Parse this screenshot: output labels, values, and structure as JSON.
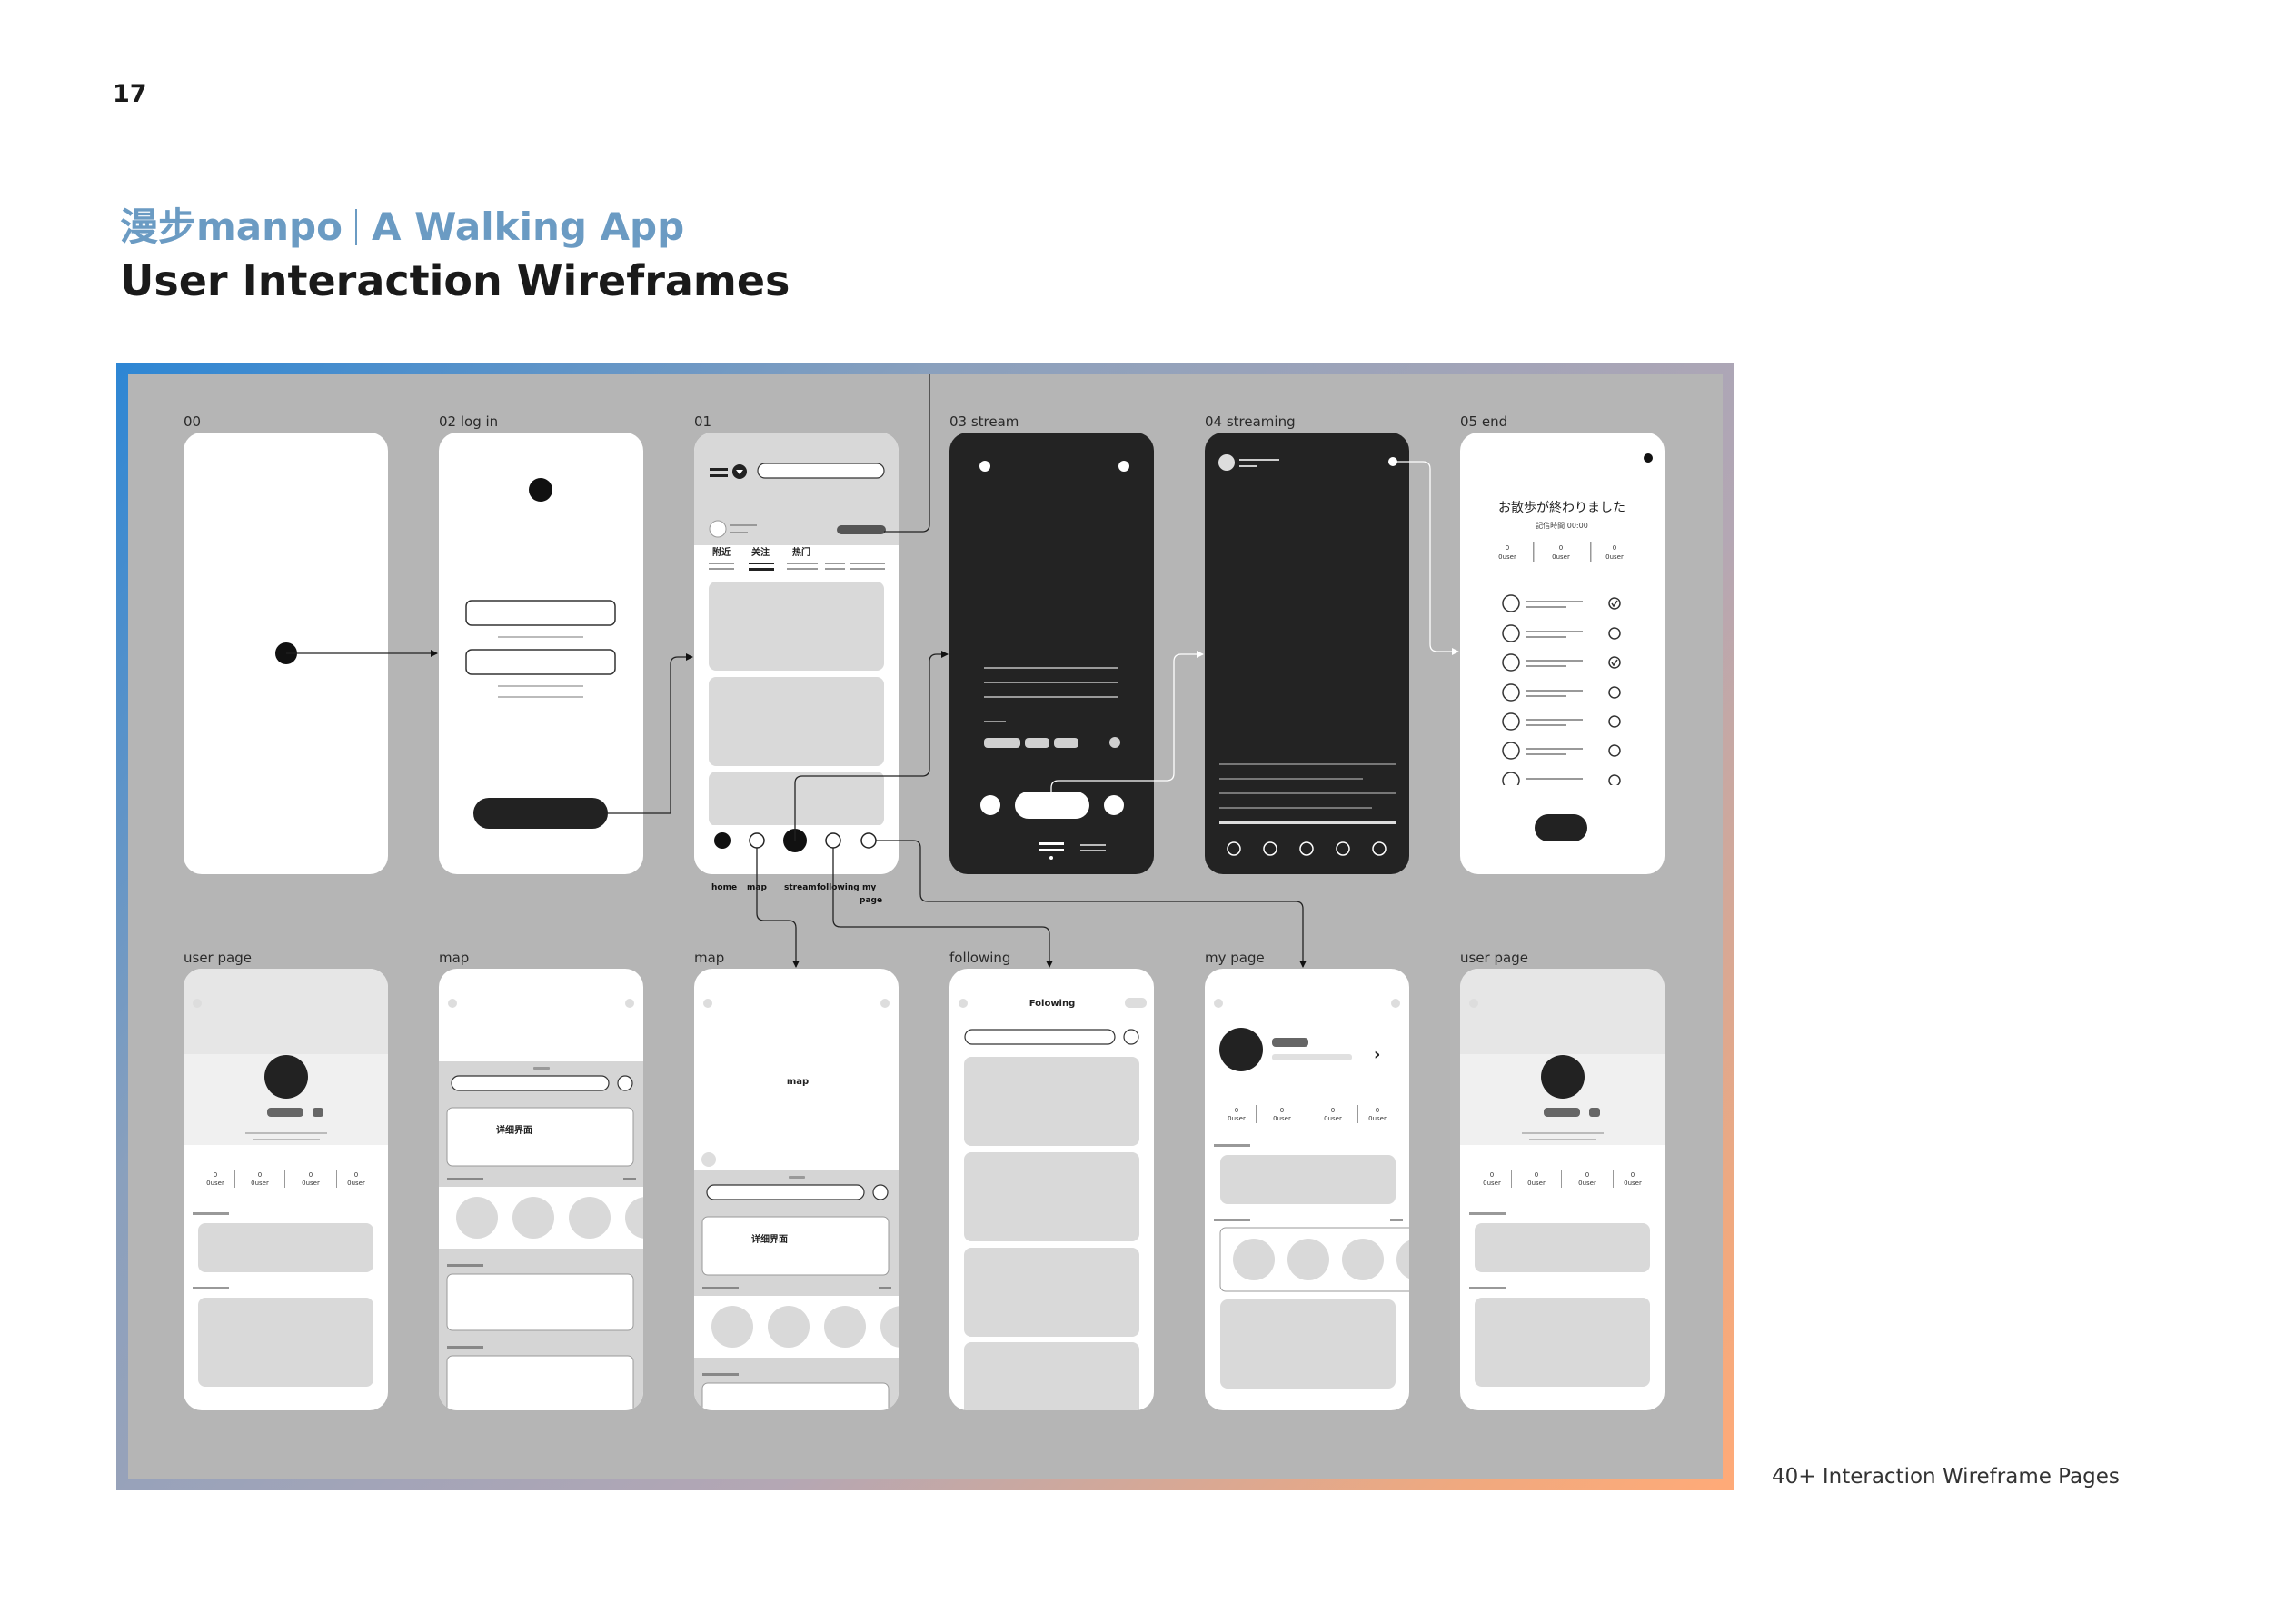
{
  "page": {
    "number": "17",
    "title_cn": "漫步manpo",
    "title_en": "A Walking App",
    "subtitle": "User Interaction Wireframes",
    "caption": "40+ Interaction Wireframe Pages"
  },
  "colors": {
    "accent": "#6b9bc3",
    "board": "#b5b5b5",
    "dark_screen": "#232323",
    "screen": "#ffffff"
  },
  "frames": {
    "labels": [
      "00",
      "02 log in",
      "01",
      "03 stream",
      "04 streaming",
      "05 end",
      "user page",
      "map",
      "map",
      "following",
      "my page",
      "user page"
    ]
  },
  "screen01": {
    "tabs": [
      "附近",
      "关注",
      "热门"
    ],
    "nav_labels": [
      "home",
      "map",
      "stream",
      "following",
      "my",
      "page"
    ]
  },
  "screen05": {
    "heading": "お散歩が終わりました",
    "sub": "記信時間 00:00",
    "stat_value": "0",
    "stat_label": "0user"
  },
  "stats": {
    "value": "0",
    "label": "0user"
  },
  "map_screen": {
    "detail_label": "详细界面",
    "map_label": "map"
  },
  "following_screen": {
    "title": "Folowing"
  },
  "my_page": {
    "chevron": "›"
  }
}
